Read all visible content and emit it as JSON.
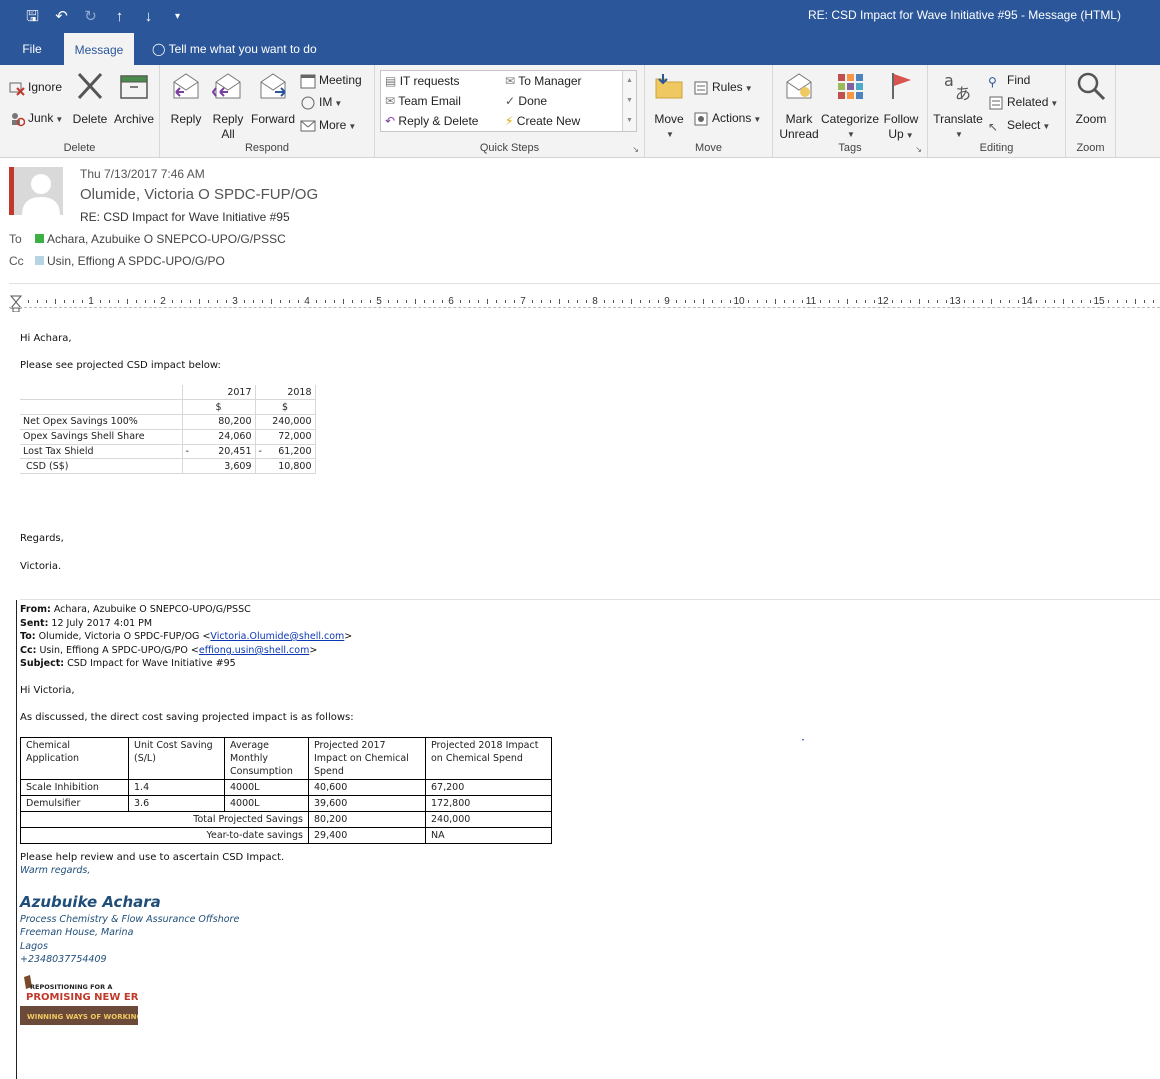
{
  "titlebar": {
    "title": "RE: CSD Impact for Wave Initiative #95  -  Message (HTML)"
  },
  "tabs": {
    "file": "File",
    "message": "Message",
    "tell_me": "Tell me what you want to do"
  },
  "ribbon": {
    "delete_group": {
      "label": "Delete",
      "ignore": "Ignore",
      "junk": "Junk",
      "delete": "Delete",
      "archive": "Archive"
    },
    "respond_group": {
      "label": "Respond",
      "reply": "Reply",
      "reply_all_1": "Reply",
      "reply_all_2": "All",
      "forward": "Forward",
      "meeting": "Meeting",
      "im": "IM",
      "more": "More"
    },
    "quick_steps": {
      "label": "Quick Steps",
      "items": [
        "IT requests",
        "To Manager",
        "Team Email",
        "Done",
        "Reply & Delete",
        "Create New"
      ]
    },
    "move_group": {
      "label": "Move",
      "move": "Move",
      "rules": "Rules",
      "actions": "Actions"
    },
    "tags_group": {
      "label": "Tags",
      "mark_unread_1": "Mark",
      "mark_unread_2": "Unread",
      "categorize": "Categorize",
      "follow_up_1": "Follow",
      "follow_up_2": "Up"
    },
    "editing_group": {
      "label": "Editing",
      "translate": "Translate",
      "find": "Find",
      "related": "Related",
      "select": "Select"
    },
    "zoom_group": {
      "label": "Zoom",
      "zoom": "Zoom"
    }
  },
  "header": {
    "date": "Thu 7/13/2017 7:46 AM",
    "from": "Olumide, Victoria O SPDC-FUP/OG",
    "subject": "RE: CSD Impact for Wave Initiative #95",
    "to_label": "To",
    "to": "Achara, Azubuike O SNEPCO-UPO/G/PSSC",
    "cc_label": "Cc",
    "cc": "Usin, Effiong A SPDC-UPO/G/PO"
  },
  "ruler": {
    "numbers": [
      "1",
      "2",
      "3",
      "4",
      "5",
      "6",
      "7",
      "8",
      "9",
      "10",
      "11",
      "12",
      "13",
      "14",
      "15"
    ]
  },
  "reply": {
    "greeting": "Hi Achara,",
    "intro": "Please see projected CSD impact below:",
    "table": {
      "years": [
        "2017",
        "2018"
      ],
      "units": [
        "$",
        "$"
      ],
      "rows": [
        {
          "label": "Net Opex Savings 100%",
          "prefix2017": "",
          "v2017": "80,200",
          "prefix2018": "",
          "v2018": "240,000"
        },
        {
          "label": "Opex Savings Shell Share",
          "prefix2017": "",
          "v2017": "24,060",
          "prefix2018": "",
          "v2018": "72,000"
        },
        {
          "label": "Lost Tax Shield",
          "prefix2017": "-",
          "v2017": "20,451",
          "prefix2018": "-",
          "v2018": "61,200"
        },
        {
          "label": "  CSD (S$)",
          "prefix2017": "",
          "v2017": "3,609",
          "prefix2018": "",
          "v2018": "10,800"
        }
      ]
    },
    "regards": "Regards,",
    "name": "Victoria."
  },
  "original": {
    "from_label": "From:",
    "from": "Achara, Azubuike O SNEPCO-UPO/G/PSSC",
    "sent_label": "Sent:",
    "sent": "12 July 2017 4:01 PM",
    "to_label": "To:",
    "to_name": "Olumide, Victoria O SPDC-FUP/OG <",
    "to_email": "Victoria.Olumide@shell.com",
    "to_end": ">",
    "cc_label": "Cc:",
    "cc_name": "Usin, Effiong A SPDC-UPO/G/PO <",
    "cc_email": "effiong.usin@shell.com",
    "cc_end": ">",
    "subject_label": "Subject:",
    "subject": "CSD Impact for Wave Initiative #95",
    "greeting": "Hi Victoria,",
    "intro": "As discussed, the direct cost saving projected impact  is as follows:",
    "table": {
      "headers": [
        "Chemical Application",
        "Unit Cost Saving (S/L)",
        "Average Monthly Consumption",
        "Projected 2017 Impact on Chemical Spend",
        "Projected 2018 Impact on Chemical Spend"
      ],
      "rows": [
        [
          "Scale Inhibition",
          "1.4",
          "4000L",
          "40,600",
          "67,200"
        ],
        [
          "Demulsifier",
          "3.6",
          "4000L",
          "39,600",
          "172,800"
        ]
      ],
      "total_label": "Total Projected Savings",
      "total_2017": "80,200",
      "total_2018": "240,000",
      "ytd_label": "Year-to-date savings",
      "ytd_2017": "29,400",
      "ytd_2018": "NA"
    },
    "closing": "Please help review and use to ascertain CSD Impact.",
    "warm": "Warm regards,",
    "sig_name": "Azubuike Achara",
    "sig_lines": [
      "Process Chemistry & Flow Assurance Offshore",
      "Freeman House, Marina",
      "Lagos",
      "+2348037754409"
    ],
    "logo": {
      "line1": "REPOSITIONING FOR A",
      "line2": "PROMISING NEW ERA",
      "line3": "WINNING WAYS OF WORKING"
    }
  }
}
